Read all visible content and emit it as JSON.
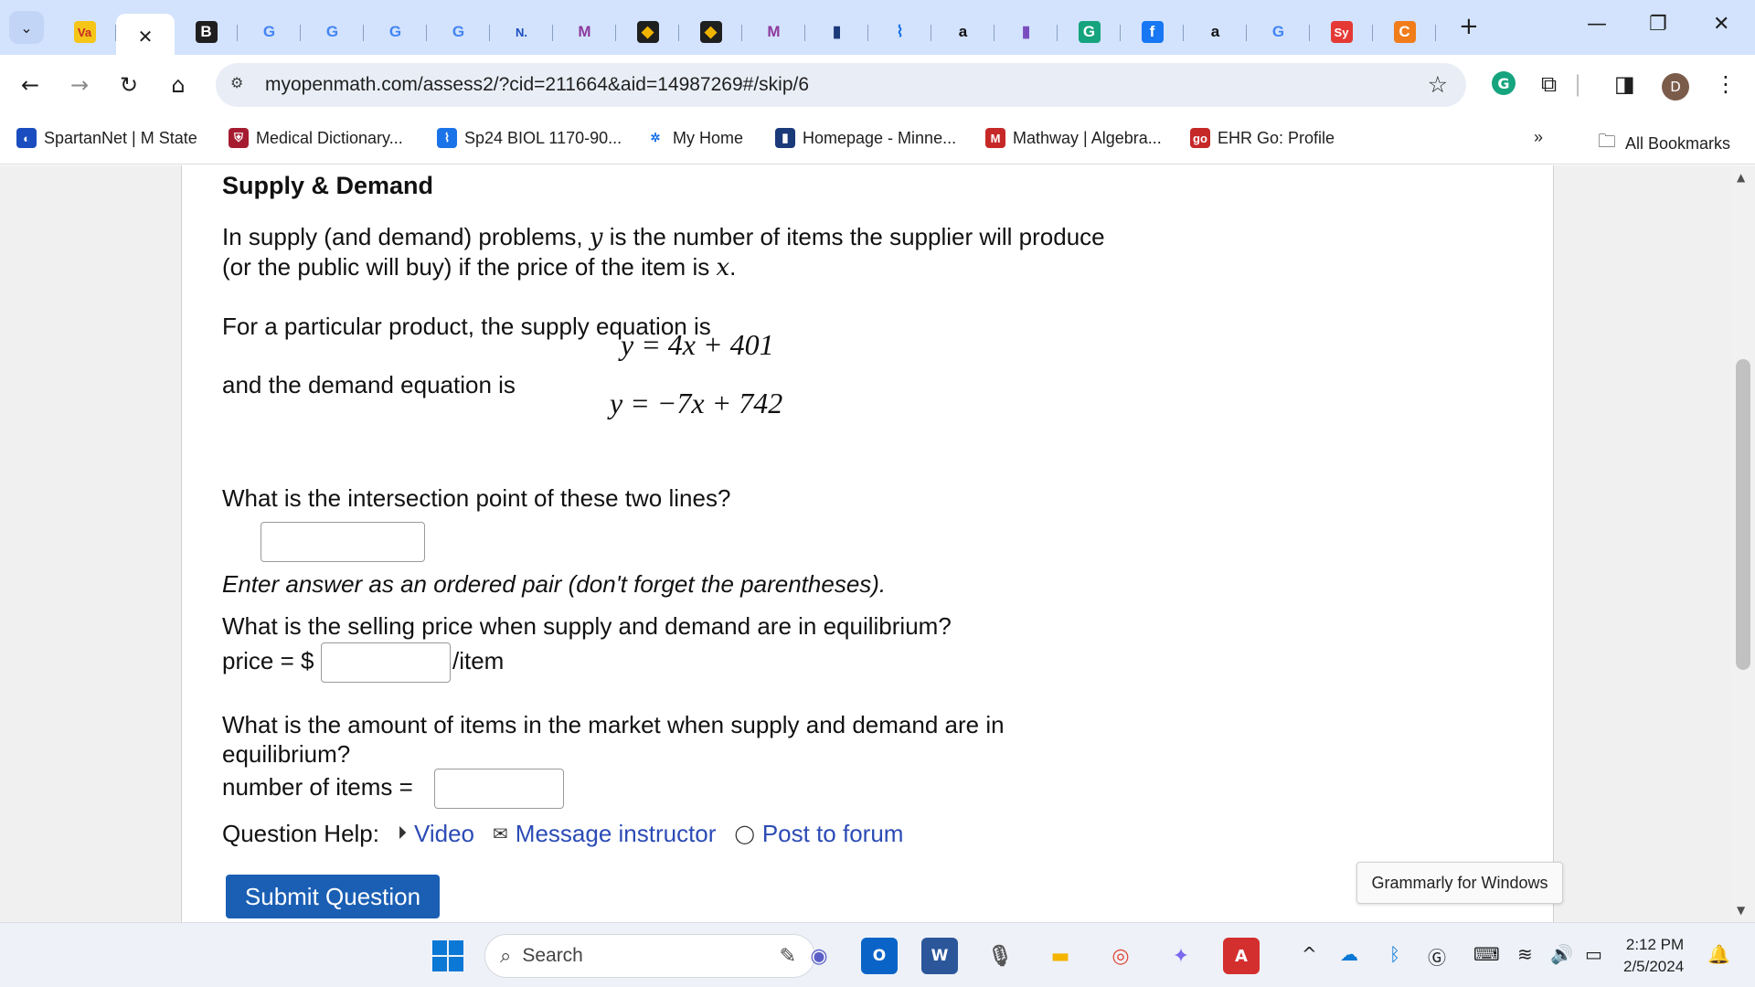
{
  "browser": {
    "tab_search_icon": "chevron-down-icon",
    "tabs": [
      {
        "glyph": "Va",
        "bg": "#f5c518",
        "fg": "#c62828"
      },
      {
        "glyph": "",
        "active": true
      },
      {
        "glyph": "B",
        "bg": "#1f1f1f",
        "fg": "#ffffff"
      },
      {
        "glyph": "G",
        "bg": "transparent",
        "fg": "#4285f4"
      },
      {
        "glyph": "G",
        "bg": "transparent",
        "fg": "#4285f4"
      },
      {
        "glyph": "G",
        "bg": "transparent",
        "fg": "#4285f4"
      },
      {
        "glyph": "G",
        "bg": "transparent",
        "fg": "#4285f4"
      },
      {
        "glyph": "N.",
        "bg": "transparent",
        "fg": "#1a4dbf"
      },
      {
        "glyph": "M",
        "bg": "transparent",
        "fg": "#8e3a9d"
      },
      {
        "glyph": "◆",
        "bg": "#1f1f1f",
        "fg": "#f0b400"
      },
      {
        "glyph": "◆",
        "bg": "#1f1f1f",
        "fg": "#f0b400"
      },
      {
        "glyph": "M",
        "bg": "transparent",
        "fg": "#8e3a9d"
      },
      {
        "glyph": "▮",
        "bg": "transparent",
        "fg": "#1a3a7a"
      },
      {
        "glyph": "⌇",
        "bg": "transparent",
        "fg": "#1a73e8"
      },
      {
        "glyph": "a",
        "bg": "transparent",
        "fg": "#111111"
      },
      {
        "glyph": "▮",
        "bg": "transparent",
        "fg": "#7a4dbf"
      },
      {
        "glyph": "G",
        "bg": "#15a47e",
        "fg": "#ffffff"
      },
      {
        "glyph": "f",
        "bg": "#1877f2",
        "fg": "#ffffff"
      },
      {
        "glyph": "a",
        "bg": "transparent",
        "fg": "#111111"
      },
      {
        "glyph": "G",
        "bg": "transparent",
        "fg": "#4285f4"
      },
      {
        "glyph": "Sy",
        "bg": "#e53935",
        "fg": "#ffffff"
      },
      {
        "glyph": "C",
        "bg": "#f07c1a",
        "fg": "#ffffff"
      }
    ],
    "tab_close_glyph": "✕",
    "new_tab_glyph": "+",
    "window_controls": {
      "minimize": "—",
      "restore": "❐",
      "close": "✕"
    },
    "url": "myopenmath.com/assess2/?cid=211664&aid=14987269#/skip/6",
    "bookmarks": [
      {
        "label": "SpartanNet | M State",
        "icon_bg": "#1a4dbf",
        "icon_glyph": "◐"
      },
      {
        "label": "Medical Dictionary...",
        "icon_bg": "#a51c30",
        "icon_glyph": "⛨"
      },
      {
        "label": "Sp24 BIOL 1170-90...",
        "icon_bg": "#1a73e8",
        "icon_glyph": "⌇"
      },
      {
        "label": "My Home",
        "icon_bg": "#ffffff",
        "icon_glyph": "✲"
      },
      {
        "label": "Homepage - Minne...",
        "icon_bg": "#1a3a7a",
        "icon_glyph": "▮"
      },
      {
        "label": "Mathway | Algebra...",
        "icon_bg": "#c62828",
        "icon_glyph": "M"
      },
      {
        "label": "EHR Go: Profile",
        "icon_bg": "#c62828",
        "icon_glyph": "go"
      }
    ],
    "bookmarks_overflow": "»",
    "all_bookmarks": "All Bookmarks",
    "avatar_letter": "D"
  },
  "question": {
    "title": "Supply & Demand",
    "intro_1": "In supply (and demand) problems, ",
    "var_y": "y",
    "intro_2": " is the number of items the supplier will produce",
    "intro_3": "(or the public will buy) if the price of the item is ",
    "var_x": "x",
    "intro_4": ".",
    "supply_text": "For a particular product, the supply equation is",
    "supply_eq": "y = 4x + 401",
    "demand_text": "and the demand equation is",
    "demand_eq": "y = −7x + 742",
    "part1_prompt": "What is the intersection point of these two lines?",
    "part1_hint": "Enter answer as an ordered pair (don't forget the parentheses).",
    "part1_value": "",
    "part2_prompt": "What is the selling price when supply and demand are in equilibrium?",
    "part2_prefix": "price = $",
    "part2_suffix": "/item",
    "part2_value": "",
    "part3_prompt_1": "What is the amount of items in the market when supply and demand are in",
    "part3_prompt_2": "equilibrium?",
    "part3_prefix": "number of items =",
    "part3_value": "",
    "help_label": "Question Help:",
    "help_video": "Video",
    "help_message": "Message instructor",
    "help_forum": "Post to forum",
    "submit_label": "Submit Question"
  },
  "tooltip": "Grammarly for Windows",
  "taskbar": {
    "search_placeholder": "Search",
    "time": "2:12 PM",
    "date": "2/5/2024"
  }
}
